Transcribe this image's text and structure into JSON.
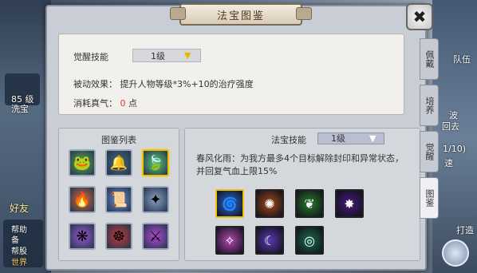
{
  "window": {
    "title": "法宝图鉴",
    "close_icon": "close-icon"
  },
  "info": {
    "awaken_label": "觉醒技能",
    "awaken_level": "1级",
    "passive_label": "被动效果：",
    "passive_text": "提升人物等级*3%+10的治疗强度",
    "cost_label": "消耗真气：",
    "cost_value": "0",
    "cost_unit": "点"
  },
  "list_panel": {
    "title": "图鉴列表",
    "items": [
      {
        "icon": "green-frog-treasure-icon",
        "glyph": "🐸",
        "color": "#5aa84a"
      },
      {
        "icon": "bronze-bell-treasure-icon",
        "glyph": "🔔",
        "color": "#3f6a7a"
      },
      {
        "icon": "jade-leaf-treasure-icon",
        "glyph": "🍃",
        "color": "#59c870",
        "selected": true
      },
      {
        "icon": "fire-gourd-treasure-icon",
        "glyph": "🔥",
        "color": "#d06a3a"
      },
      {
        "icon": "scroll-treasure-icon",
        "glyph": "📜",
        "color": "#6a8ad0"
      },
      {
        "icon": "spear-treasure-icon",
        "glyph": "✦",
        "color": "#8aa0c0"
      },
      {
        "icon": "purple-fan-treasure-icon",
        "glyph": "❋",
        "color": "#9a5ad0"
      },
      {
        "icon": "red-wheel-treasure-icon",
        "glyph": "☸",
        "color": "#c03a3a"
      },
      {
        "icon": "violet-blade-treasure-icon",
        "glyph": "⚔",
        "color": "#b04ad0"
      }
    ]
  },
  "skill_panel": {
    "label": "法宝技能",
    "level": "1级",
    "description": "春风化雨：为我方最多4个目标解除封印和异常状态，并回复气血上限15%",
    "skills": [
      {
        "icon": "water-swirl-skill-icon",
        "glyph": "🌀",
        "color": "#2a6ad0",
        "selected": true
      },
      {
        "icon": "sun-burst-skill-icon",
        "glyph": "✺",
        "color": "#a04a1a"
      },
      {
        "icon": "green-spirit-skill-icon",
        "glyph": "❦",
        "color": "#2a7a2a"
      },
      {
        "icon": "dark-orb-skill-icon",
        "glyph": "✸",
        "color": "#4a1a7a"
      },
      {
        "icon": "pink-slash-skill-icon",
        "glyph": "✧",
        "color": "#b04ab0"
      },
      {
        "icon": "violet-wave-skill-icon",
        "glyph": "☾",
        "color": "#5a3ab0"
      },
      {
        "icon": "green-vortex-skill-icon",
        "glyph": "◎",
        "color": "#1a6a4a"
      }
    ]
  },
  "tabs": [
    {
      "label": "佩戴"
    },
    {
      "label": "培养"
    },
    {
      "label": "觉醒"
    },
    {
      "label": "图鉴",
      "active": true
    }
  ],
  "background": {
    "left_texts": [
      "85 级",
      "洗宝",
      "好友",
      "帮助",
      "备",
      "帮股",
      "世界"
    ],
    "right_texts": [
      "队伍",
      "波",
      "回去",
      "1/10)",
      "速",
      "打造"
    ]
  }
}
